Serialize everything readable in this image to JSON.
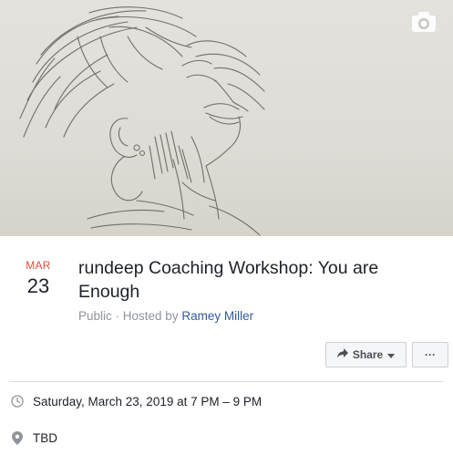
{
  "event": {
    "month": "MAR",
    "day": "23",
    "title": "rundeep Coaching Workshop: You are Enough",
    "visibility": "Public",
    "separator": " · ",
    "hosted_prefix": "Hosted by ",
    "host": "Ramey Miller",
    "datetime": "Saturday, March 23, 2019 at 7 PM – 9 PM",
    "location": "TBD"
  },
  "actions": {
    "share_label": "Share",
    "more_label": "···"
  },
  "icons": {
    "cover": "camera-icon",
    "share": "share-arrow-icon",
    "dropdown": "caret-down-icon",
    "time": "clock-icon",
    "location": "map-pin-icon"
  },
  "colors": {
    "month": "#e14b3b",
    "link": "#365899",
    "muted": "#90949c",
    "text": "#1d2129"
  }
}
